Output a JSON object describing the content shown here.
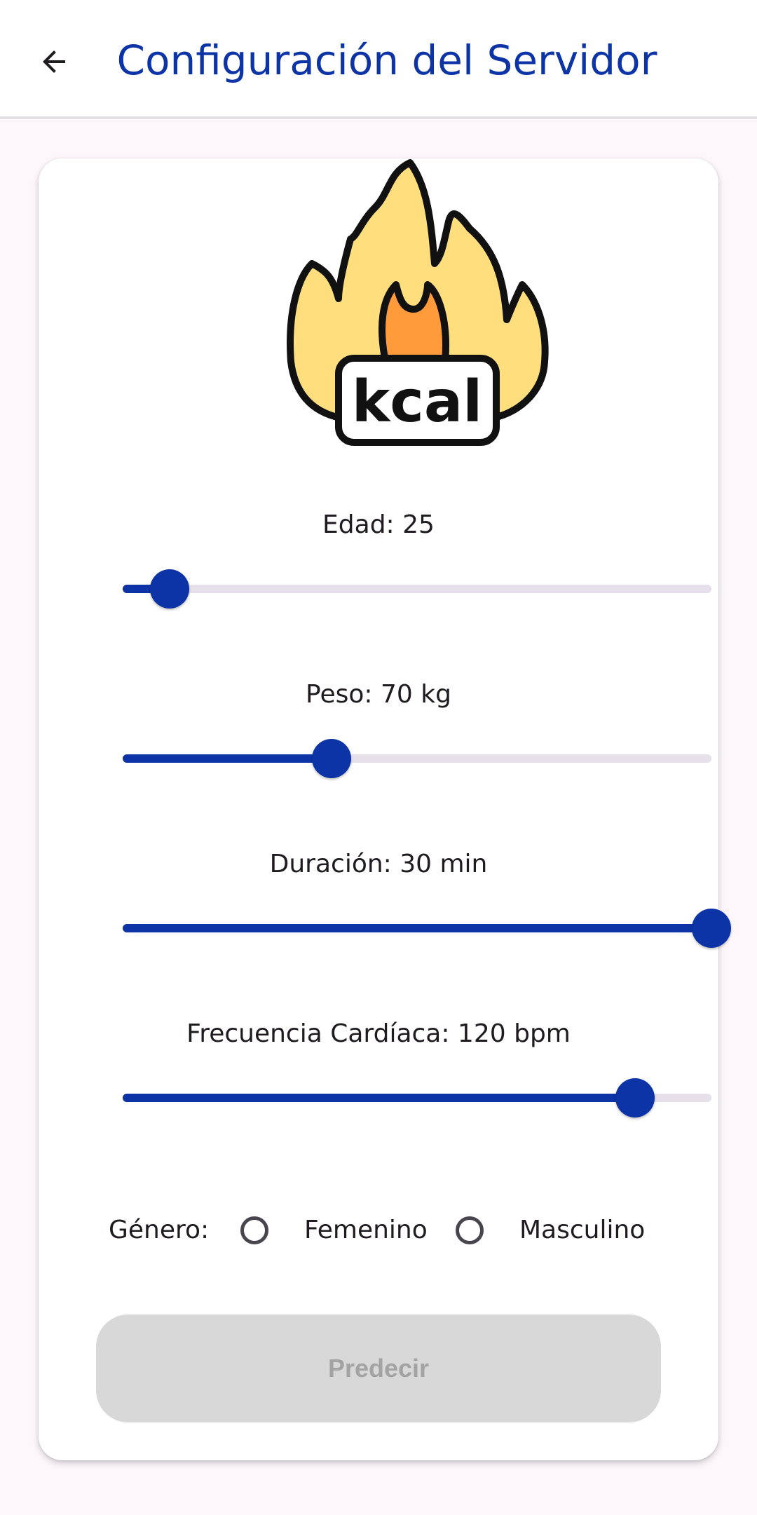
{
  "appbar": {
    "title": "Configuración del Servidor",
    "back_icon": "arrow-left-icon",
    "title_color": "#0d34a6"
  },
  "logo": {
    "icon": "kcal-flame-icon",
    "text": "kcal"
  },
  "sliders": [
    {
      "label": "Edad: 25",
      "value_fraction": 0.08
    },
    {
      "label": "Peso: 70 kg",
      "value_fraction": 0.355
    },
    {
      "label": "Duración: 30 min",
      "value_fraction": 1.0
    },
    {
      "label": "Frecuencia Cardíaca: 120 bpm",
      "value_fraction": 0.87
    }
  ],
  "gender": {
    "label": "Género:",
    "options": [
      "Femenino",
      "Masculino"
    ],
    "selected": null
  },
  "predict_button": {
    "label": "Predecir",
    "enabled": false
  },
  "colors": {
    "accent": "#0d34a6",
    "track_inactive": "#e5e0ea",
    "background": "#fdf7fc",
    "button_disabled_bg": "#d8d8d8",
    "button_disabled_text": "#a3a3a3"
  }
}
